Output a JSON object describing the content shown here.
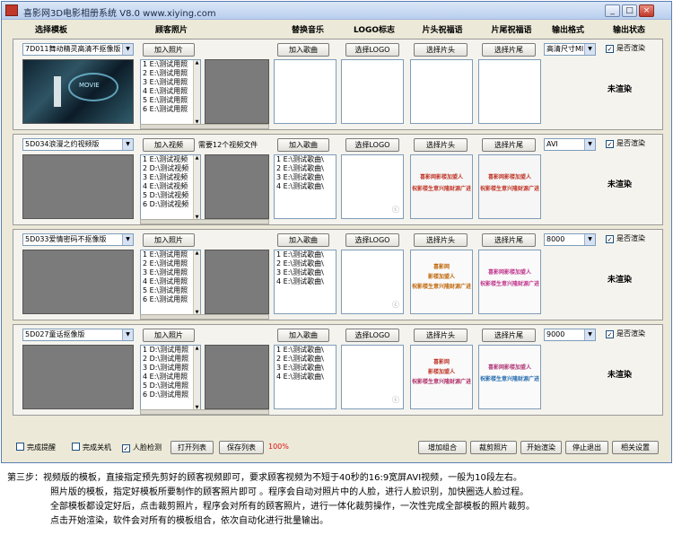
{
  "window": {
    "title": "喜影网3D电影相册系统 V8.0   www.xiying.com",
    "min": "_",
    "max": "□",
    "close": "×"
  },
  "headers": [
    "选择模板",
    "顾客照片",
    "替换音乐",
    "LOGO标志",
    "片头祝福语",
    "片尾祝福语",
    "输出格式",
    "输出状态"
  ],
  "rows": [
    {
      "template": "7D011舞动精灵高清不抠像版",
      "add_btn": "加入照片",
      "note": "",
      "list": [
        "1 E:\\测试用照",
        "2 E:\\测试用照",
        "3 E:\\测试用照",
        "4 E:\\测试用照",
        "5 E:\\测试用照",
        "6 E:\\测试用照"
      ],
      "music_btn": "加入歌曲",
      "music": [],
      "logo_btn": "选择LOGO",
      "head_btn": "选择片头",
      "tail_btn": "选择片尾",
      "head_text": [],
      "tail_text": [],
      "format": "高清尺寸MI",
      "render_label": "是否渲染",
      "status": "未渲染",
      "scene_text": "MOVIE"
    },
    {
      "template": "5D034浪漫之约视频版",
      "add_btn": "加入视频",
      "note": "需要12个视频文件",
      "list": [
        "1 E:\\测试视频",
        "2 D:\\测试视频",
        "3 E:\\测试视频",
        "4 E:\\测试视频",
        "5 D:\\测试视频",
        "6 D:\\测试视频"
      ],
      "music_btn": "加入歌曲",
      "music": [
        "1 E:\\测试歌曲\\",
        "2 E:\\测试歌曲\\",
        "3 E:\\测试歌曲\\",
        "4 E:\\测试歌曲\\"
      ],
      "logo_btn": "选择LOGO",
      "head_btn": "选择片头",
      "tail_btn": "选择片尾",
      "head_text": [
        "喜影网影楼加盟人",
        "祝影楼生意兴隆财源广进"
      ],
      "tail_text": [
        "喜影网影楼加盟人",
        "祝影楼生意兴隆财源广进"
      ],
      "format": "AVI",
      "render_label": "是否渲染",
      "status": "未渲染",
      "scene_text": ""
    },
    {
      "template": "5D033爱情密码不抠像版",
      "add_btn": "加入照片",
      "note": "",
      "list": [
        "1 E:\\测试用照",
        "2 E:\\测试用照",
        "3 E:\\测试用照",
        "4 E:\\测试用照",
        "5 E:\\测试用照",
        "6 E:\\测试用照"
      ],
      "music_btn": "加入歌曲",
      "music": [
        "1 E:\\测试歌曲\\",
        "2 E:\\测试歌曲\\",
        "3 E:\\测试歌曲\\",
        "4 E:\\测试歌曲\\"
      ],
      "logo_btn": "选择LOGO",
      "head_btn": "选择片头",
      "tail_btn": "选择片尾",
      "head_text": [
        "喜影网",
        "影楼加盟人",
        "祝影楼生意兴隆财源广进"
      ],
      "tail_text": [
        "喜影网影楼加盟人",
        "祝影楼生意兴隆财源广进"
      ],
      "format": "8000",
      "render_label": "是否渲染",
      "status": "未渲染",
      "scene_text": ""
    },
    {
      "template": "5D027童话抠像版",
      "add_btn": "加入照片",
      "note": "",
      "list": [
        "1 D:\\测试用照",
        "2 D:\\测试用照",
        "3 D:\\测试用照",
        "4 E:\\测试用照",
        "5 D:\\测试用照",
        "6 D:\\测试用照"
      ],
      "music_btn": "加入歌曲",
      "music": [
        "1 E:\\测试歌曲\\",
        "2 E:\\测试歌曲\\",
        "3 E:\\测试歌曲\\",
        "4 E:\\测试歌曲\\"
      ],
      "logo_btn": "选择LOGO",
      "head_btn": "选择片头",
      "tail_btn": "选择片尾",
      "head_text": [
        "喜影网",
        "影楼加盟人",
        "祝影楼生意兴隆财源广进"
      ],
      "tail_text": [
        "喜影网影楼加盟人",
        "祝影楼生意兴隆财源广进"
      ],
      "format": "9000",
      "render_label": "是否渲染",
      "status": "未渲染",
      "scene_text": ""
    }
  ],
  "bottom": {
    "done_remind": "完成提醒",
    "done_shutdown": "完成关机",
    "face_detect": "人脸检测",
    "open_list": "打开列表",
    "save_list": "保存列表",
    "percent": "100%",
    "add_group": "增加组合",
    "crop": "裁剪照片",
    "start": "开始渲染",
    "stop": "停止退出",
    "settings": "相关设置"
  },
  "instructions": [
    "第三步：视频版的模板，直接指定预先剪好的顾客视频即可，要求顾客视频为不短于40秒的16:9宽屏AVI视频，一般为10段左右。",
    "照片版的模板，指定好模板所要制作的顾客照片即可 。程序会自动对照片中的人脸，进行人脸识别，加快圈选人脸过程。",
    "全部模板都设定好后，点击裁剪照片，程序会对所有的顾客照片，进行一体化裁剪操作，一次性完成全部模板的照片裁剪。",
    "点击开始渲染，软件会对所有的模板组合，依次自动化进行批量输出。"
  ],
  "colors": {
    "accent": "#d11111",
    "title_bar": "#b9cfee",
    "thumb_gray": "#7b7b7b"
  }
}
